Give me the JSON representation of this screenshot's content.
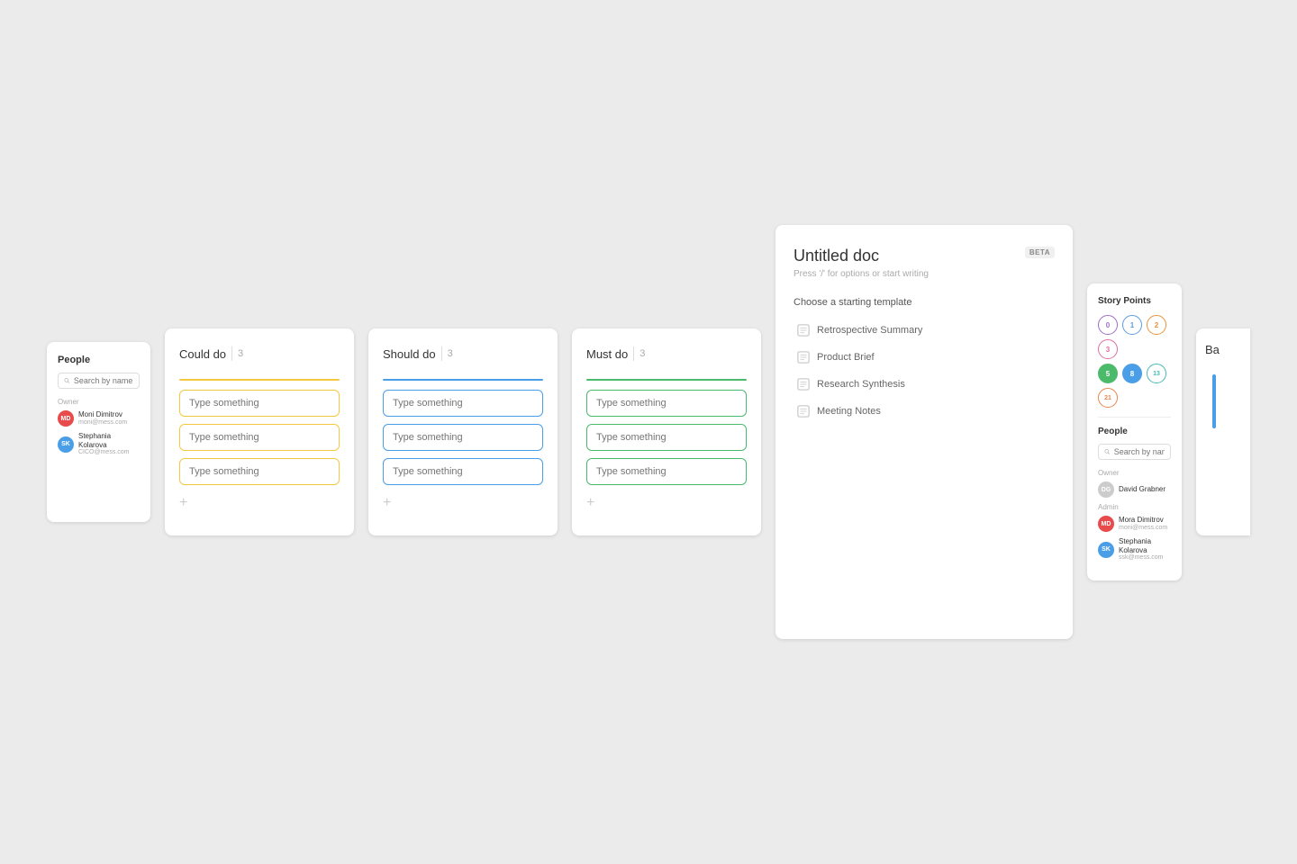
{
  "people_card": {
    "title": "People",
    "search_placeholder": "Search by name or email",
    "section_label": "Owner",
    "people": [
      {
        "name": "Moni Dimitrov",
        "email": "moni@mess.com",
        "avatar_color": "#e84b4b",
        "initials": "MD"
      },
      {
        "name": "Stephania Kolarova",
        "email": "CICO@mess.com",
        "avatar_color": "#4a9ee8",
        "initials": "SK"
      }
    ]
  },
  "could_do": {
    "title": "Could do",
    "count": "3",
    "placeholder": "Type something",
    "tasks": [
      "Type something",
      "Type something",
      "Type something"
    ],
    "border_color": "#f5c842",
    "add_label": "+"
  },
  "should_do": {
    "title": "Should do",
    "count": "3",
    "placeholder": "Type something",
    "tasks": [
      "Type something",
      "Type something",
      "Type something"
    ],
    "border_color": "#4a9ee8",
    "add_label": "+"
  },
  "must_do": {
    "title": "Must do",
    "count": "3",
    "placeholder": "Type something",
    "tasks": [
      "Type something",
      "Type something",
      "Type something"
    ],
    "border_color": "#4cba6b",
    "add_label": "+"
  },
  "doc_card": {
    "title": "Untitled doc",
    "hint": "Press '/' for options or start writing",
    "beta_label": "BETA",
    "template_section": "Choose a starting template",
    "templates": [
      "Retrospective Summary",
      "Product Brief",
      "Research Synthesis",
      "Meeting Notes"
    ]
  },
  "story_points_card": {
    "title": "Story Points",
    "points_row1": [
      "0",
      "1",
      "2",
      "3"
    ],
    "points_row2": [
      "5",
      "8",
      "13",
      "21"
    ],
    "people_title": "People",
    "search_placeholder": "Search by name or email",
    "owner_label": "Owner",
    "owner": {
      "name": "David Grabner",
      "avatar_color": "#ccc",
      "initials": "DG"
    },
    "admin_label": "Admin",
    "admins": [
      {
        "name": "Mora Dimitrov",
        "email": "moni@mess.com",
        "avatar_color": "#e84b4b",
        "initials": "MD"
      },
      {
        "name": "Stephania Kolarova",
        "email": "ssk@mess.com",
        "avatar_color": "#4a9ee8",
        "initials": "SK"
      }
    ]
  },
  "partial_card": {
    "title": "Ba"
  }
}
